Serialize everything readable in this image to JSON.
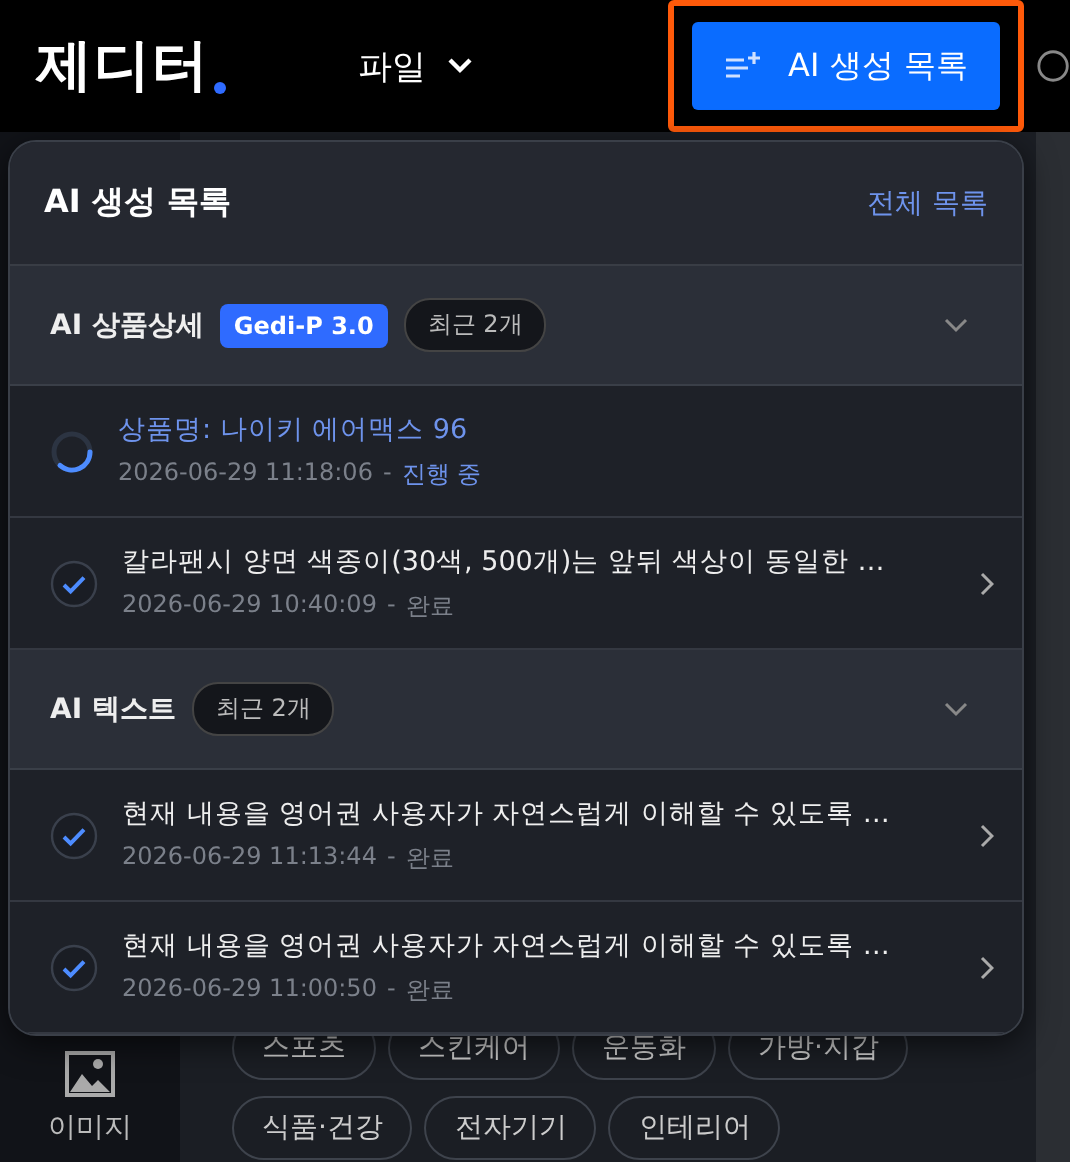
{
  "header": {
    "logo": "제디터",
    "menu": "파일",
    "ai_button": "AI 생성 목록"
  },
  "background": {
    "sidebar_item": "이미지",
    "tags": [
      [
        "스포츠",
        "스킨케어",
        "운동화",
        "가방·지갑"
      ],
      [
        "식품·건강",
        "전자기기",
        "인테리어"
      ]
    ]
  },
  "panel": {
    "title": "AI 생성 목록",
    "link": "전체 목록",
    "sections": [
      {
        "title": "AI 상품상세",
        "badge": "Gedi-P 3.0",
        "count": "최근 2개",
        "expanded": true,
        "items": [
          {
            "title": "상품명: 나이키 에어맥스 96",
            "time": "2026-06-29 11:18:06",
            "separator": "-",
            "status": "진행 중",
            "kind": "progress"
          },
          {
            "title": "칼라팬시 양면 색종이(30색, 500개)는 앞뒤 색상이 동일한 …",
            "time": "2026-06-29 10:40:09",
            "separator": "-",
            "status": "완료",
            "kind": "done"
          }
        ]
      },
      {
        "title": "AI 텍스트",
        "count": "최근 2개",
        "expanded": true,
        "items": [
          {
            "title": "현재 내용을 영어권 사용자가 자연스럽게 이해할 수 있도록 …",
            "time": "2026-06-29 11:13:44",
            "separator": "-",
            "status": "완료",
            "kind": "done"
          },
          {
            "title": "현재 내용을 영어권 사용자가 자연스럽게 이해할 수 있도록 …",
            "time": "2026-06-29 11:00:50",
            "separator": "-",
            "status": "완료",
            "kind": "done"
          }
        ]
      }
    ]
  }
}
